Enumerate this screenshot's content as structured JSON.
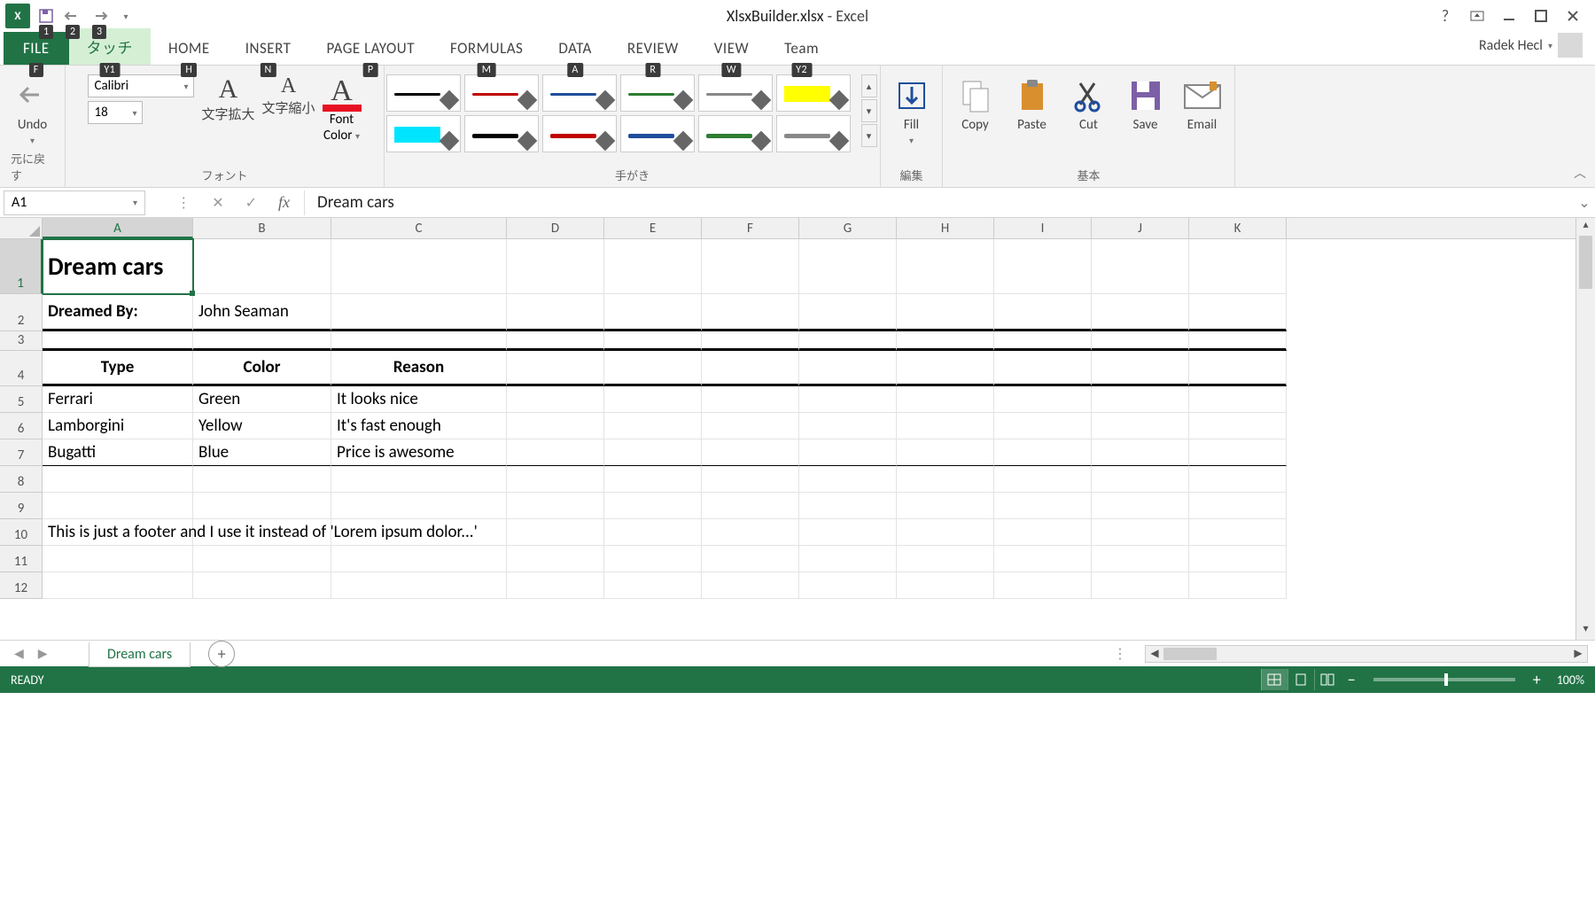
{
  "title": {
    "filename": "XlsxBuilder.xlsx",
    "app": "Excel"
  },
  "qat": {
    "k1": "1",
    "k2": "2",
    "k3": "3"
  },
  "tabs": {
    "file": "FILE",
    "file_key": "F",
    "touch": "タッチ",
    "touch_key": "Y1",
    "home": "HOME",
    "home_key": "H",
    "insert": "INSERT",
    "insert_key": "N",
    "pagelayout": "PAGE LAYOUT",
    "pagelayout_key": "P",
    "formulas": "FORMULAS",
    "formulas_key": "M",
    "data": "DATA",
    "data_key": "A",
    "review": "REVIEW",
    "review_key": "R",
    "view": "VIEW",
    "view_key": "W",
    "team": "Team",
    "team_key": "Y2"
  },
  "account": "Radek Hecl",
  "ribbon": {
    "undo_group": "元に戻す",
    "undo": "Undo",
    "font_group": "フォント",
    "font_name": "Calibri",
    "font_size": "18",
    "enlarge": "文字拡大",
    "shrink": "文字縮小",
    "font_color": "Font",
    "font_color2": "Color",
    "pen_group": "手がき",
    "edit_group": "編集",
    "fill": "Fill",
    "basic_group": "基本",
    "copy": "Copy",
    "paste": "Paste",
    "cut": "Cut",
    "save": "Save",
    "email": "Email"
  },
  "fbar": {
    "name": "A1",
    "formula": "Dream cars"
  },
  "cols": [
    "A",
    "B",
    "C",
    "D",
    "E",
    "F",
    "G",
    "H",
    "I",
    "J",
    "K"
  ],
  "rows": [
    "1",
    "2",
    "3",
    "4",
    "5",
    "6",
    "7",
    "8",
    "9",
    "10",
    "11",
    "12"
  ],
  "sheet": {
    "a1": "Dream cars",
    "a2": "Dreamed By:",
    "b2": "John Seaman",
    "a4": "Type",
    "b4": "Color",
    "c4": "Reason",
    "a5": "Ferrari",
    "b5": "Green",
    "c5": "It looks nice",
    "a6": "Lamborgini",
    "b6": "Yellow",
    "c6": "It's fast enough",
    "a7": "Bugatti",
    "b7": "Blue",
    "c7": "Price is awesome",
    "a10": "This is just a footer and I use it instead of 'Lorem ipsum dolor...'"
  },
  "tabsheet": "Dream cars",
  "status": {
    "ready": "READY",
    "zoom": "100%"
  }
}
